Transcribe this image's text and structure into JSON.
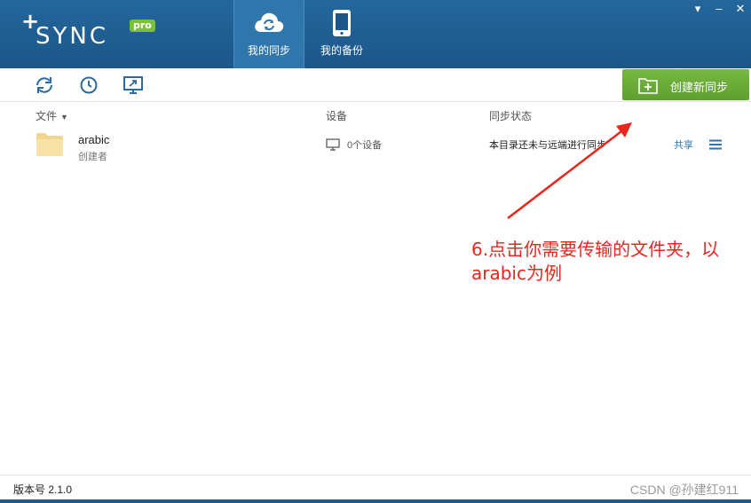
{
  "header": {
    "logo_plus": "+",
    "logo_text": "SYNC",
    "logo_badge": "pro",
    "tabs": [
      {
        "label": "我的同步",
        "icon": "cloud-sync-icon",
        "active": true
      },
      {
        "label": "我的备份",
        "icon": "phone-icon",
        "active": false
      }
    ],
    "window_controls": {
      "menu": "▾",
      "minimize": "–",
      "close": "✕"
    }
  },
  "toolbar": {
    "create_label": "创建新同步",
    "icons": [
      "refresh-icon",
      "history-icon",
      "device-icon"
    ]
  },
  "columns": {
    "file": "文件",
    "device": "设备",
    "status": "同步状态"
  },
  "rows": [
    {
      "name": "arabic",
      "creator": "创建者",
      "devices": "0个设备",
      "status": "本目录还未与远端进行同步",
      "share": "共享"
    }
  ],
  "annotation": {
    "text_line1": "6.点击你需要传输的文件夹，以",
    "text_line2": "arabic为例",
    "color": "#e8261e"
  },
  "footer": {
    "version": "版本号 2.1.0",
    "watermark": "CSDN @孙建红911"
  },
  "colors": {
    "header": "#1e5b8c",
    "accent_green": "#6aad36",
    "link_blue": "#2b77b5"
  }
}
